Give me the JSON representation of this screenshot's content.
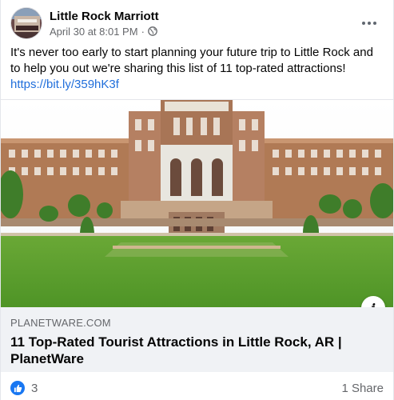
{
  "post": {
    "author": "Little Rock Marriott",
    "timestamp": "April 30 at 8:01 PM",
    "separator": "·",
    "audience_icon": "globe-icon",
    "body_text": "It's never too early to start planning your future trip to Little Rock and to help you out we're sharing this list of 11 top-rated attractions!",
    "link_url": "https://bit.ly/359hK3f"
  },
  "link_preview": {
    "domain": "PLANETWARE.COM",
    "title": "11 Top-Rated Tourist Attractions in Little Rock, AR | PlanetWare",
    "info_icon": "info-icon"
  },
  "footer": {
    "reaction_icon": "like-icon",
    "reaction_count": "3",
    "share_count": "1 Share"
  },
  "colors": {
    "link": "#216fdb",
    "like": "#1877f2",
    "secondary_text": "#65676b",
    "card_background": "#f0f2f5"
  }
}
